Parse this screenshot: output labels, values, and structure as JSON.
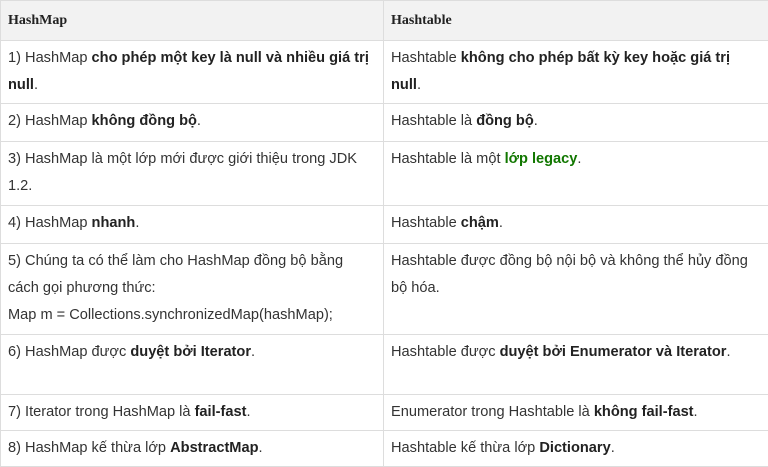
{
  "headers": [
    "HashMap",
    "Hashtable"
  ],
  "rows": [
    {
      "left": [
        {
          "t": "1) HashMap "
        },
        {
          "t": "cho phép một key là null và nhiều giá trị null",
          "b": true
        },
        {
          "t": "."
        }
      ],
      "right": [
        {
          "t": "Hashtable "
        },
        {
          "t": "không cho phép bất kỳ key hoặc giá trị null",
          "b": true
        },
        {
          "t": "."
        }
      ]
    },
    {
      "left": [
        {
          "t": "2) HashMap "
        },
        {
          "t": "không đồng bộ",
          "b": true
        },
        {
          "t": "."
        }
      ],
      "right": [
        {
          "t": "Hashtable là "
        },
        {
          "t": "đồng bộ",
          "b": true
        },
        {
          "t": "."
        }
      ]
    },
    {
      "left": [
        {
          "t": "3) HashMap là một lớp mới được giới thiệu trong JDK 1.2."
        }
      ],
      "right": [
        {
          "t": "Hashtable là một "
        },
        {
          "t": "lớp legacy",
          "b": true,
          "c": "green"
        },
        {
          "t": "."
        }
      ]
    },
    {
      "left": [
        {
          "t": "4) HashMap "
        },
        {
          "t": "nhanh",
          "b": true
        },
        {
          "t": "."
        }
      ],
      "right": [
        {
          "t": "Hashtable "
        },
        {
          "t": "chậm",
          "b": true
        },
        {
          "t": "."
        }
      ]
    },
    {
      "left": [
        {
          "t": "5) Chúng ta có thể làm cho HashMap đồng bộ bằng cách gọi phương thức:"
        },
        {
          "br": true
        },
        {
          "t": "Map m = Collections.synchronizedMap(hashMap);"
        }
      ],
      "right": [
        {
          "t": "Hashtable được đồng bộ nội bộ và không thể hủy đồng bộ hóa."
        }
      ]
    },
    {
      "left": [
        {
          "t": "6) HashMap được "
        },
        {
          "t": "duyệt bởi Iterator",
          "b": true
        },
        {
          "t": "."
        }
      ],
      "right": [
        {
          "t": "Hashtable được "
        },
        {
          "t": "duyệt bởi Enumerator và Iterator",
          "b": true
        },
        {
          "t": "."
        }
      ]
    },
    {
      "left": [
        {
          "t": "7) Iterator trong HashMap là "
        },
        {
          "t": "fail-fast",
          "b": true
        },
        {
          "t": "."
        }
      ],
      "right": [
        {
          "t": "Enumerator trong Hashtable là "
        },
        {
          "t": "không fail-fast",
          "b": true
        },
        {
          "t": "."
        }
      ]
    },
    {
      "left": [
        {
          "t": "8) HashMap kế thừa lớp "
        },
        {
          "t": "AbstractMap",
          "b": true
        },
        {
          "t": "."
        }
      ],
      "right": [
        {
          "t": "Hashtable kế thừa lớp "
        },
        {
          "t": "Dictionary",
          "b": true
        },
        {
          "t": "."
        }
      ]
    }
  ]
}
